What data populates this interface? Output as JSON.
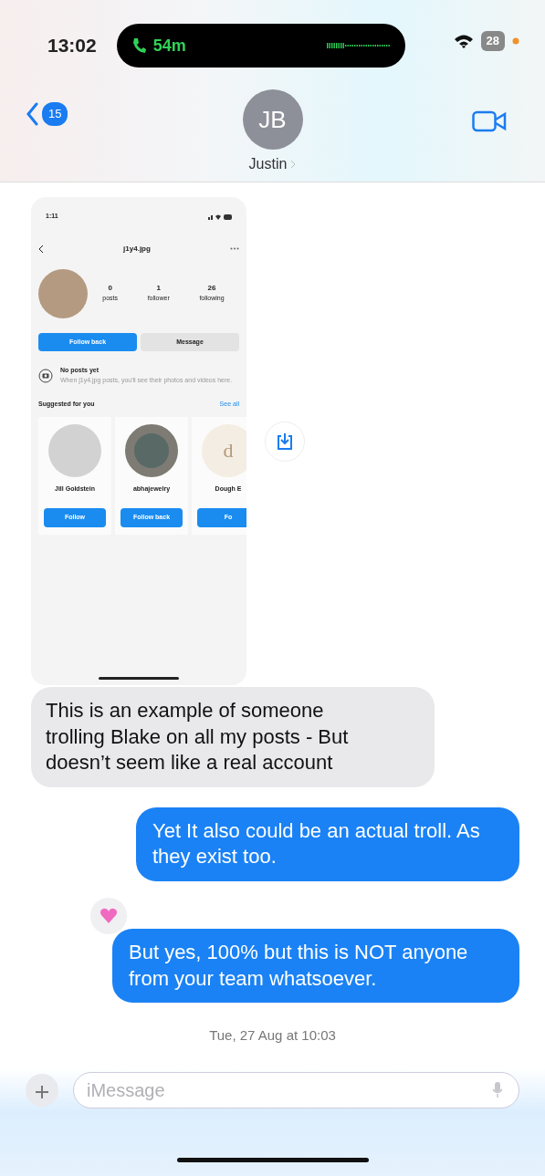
{
  "status_bar": {
    "time": "13:02",
    "call_duration": "54m",
    "battery": "28"
  },
  "header": {
    "back_badge": "15",
    "avatar_initials": "JB",
    "contact_name": "Justin"
  },
  "messages": [
    {
      "kind": "screenshot",
      "screenshot": {
        "time": "1:11",
        "username": "j1y4.jpg",
        "stats": [
          {
            "value": "0",
            "label": "posts"
          },
          {
            "value": "1",
            "label": "follower"
          },
          {
            "value": "26",
            "label": "following"
          }
        ],
        "buttons": [
          {
            "label": "Follow back",
            "kind": "primary"
          },
          {
            "label": "Message",
            "kind": "secondary"
          }
        ],
        "empty_title": "No posts yet",
        "empty_text": "When j1y4.jpg posts, you'll see their photos and videos here.",
        "suggested_title": "Suggested for you",
        "see_all": "See all",
        "suggestions": [
          {
            "name": "Jill Goldstein",
            "button": "Follow",
            "kind": "blank"
          },
          {
            "name": "abhajewelry",
            "button": "Follow back",
            "kind": "ring"
          },
          {
            "name": "Dough E",
            "button": "Fo",
            "kind": "logo",
            "logo_text": "d"
          }
        ]
      }
    },
    {
      "kind": "text",
      "outgoing": false,
      "text": "This is an example of someone trolling Blake on all my posts - But doesn’t seem like a real account"
    },
    {
      "kind": "text",
      "outgoing": true,
      "text": "Yet It also could be an actual troll. As they exist too."
    },
    {
      "kind": "text",
      "outgoing": true,
      "text": "But yes, 100% but this is NOT anyone from your team whatsoever.",
      "reaction": {
        "kind": "heart"
      }
    }
  ],
  "timestamp": "Tue, 27 Aug at 10:03",
  "composer": {
    "placeholder": "iMessage"
  }
}
